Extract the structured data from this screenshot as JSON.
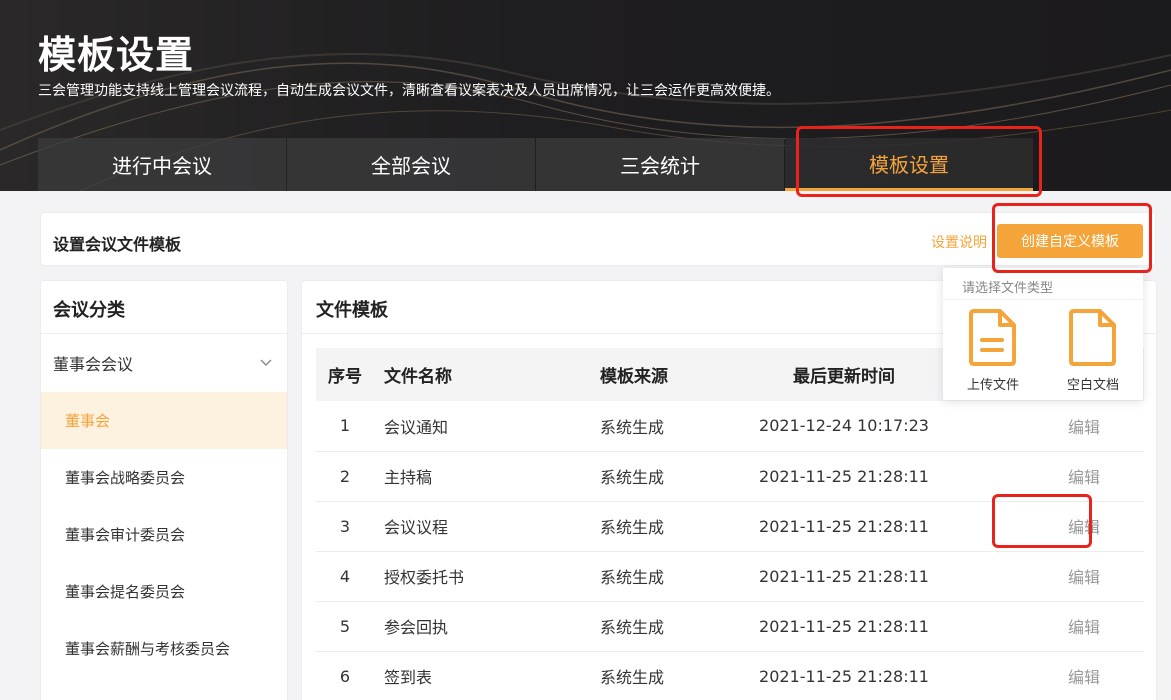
{
  "hero": {
    "title": "模板设置",
    "subtitle": "三会管理功能支持线上管理会议流程，自动生成会议文件，清晰查看议案表决及人员出席情况，让三会运作更高效便捷。"
  },
  "tabs": [
    {
      "label": "进行中会议",
      "active": false
    },
    {
      "label": "全部会议",
      "active": false
    },
    {
      "label": "三会统计",
      "active": false
    },
    {
      "label": "模板设置",
      "active": true
    }
  ],
  "toolbar": {
    "title": "设置会议文件模板",
    "help_label": "设置说明",
    "create_label": "创建自定义模板"
  },
  "sidebar": {
    "title": "会议分类",
    "group_label": "董事会会议",
    "items": [
      {
        "label": "董事会",
        "active": true
      },
      {
        "label": "董事会战略委员会",
        "active": false
      },
      {
        "label": "董事会审计委员会",
        "active": false
      },
      {
        "label": "董事会提名委员会",
        "active": false
      },
      {
        "label": "董事会薪酬与考核委员会",
        "active": false
      }
    ]
  },
  "main": {
    "title": "文件模板",
    "columns": [
      "序号",
      "文件名称",
      "模板来源",
      "最后更新时间"
    ],
    "rows": [
      {
        "no": "1",
        "name": "会议通知",
        "source": "系统生成",
        "time": "2021-12-24 10:17:23",
        "action": "编辑"
      },
      {
        "no": "2",
        "name": "主持稿",
        "source": "系统生成",
        "time": "2021-11-25 21:28:11",
        "action": "编辑"
      },
      {
        "no": "3",
        "name": "会议议程",
        "source": "系统生成",
        "time": "2021-11-25 21:28:11",
        "action": "编辑"
      },
      {
        "no": "4",
        "name": "授权委托书",
        "source": "系统生成",
        "time": "2021-11-25 21:28:11",
        "action": "编辑"
      },
      {
        "no": "5",
        "name": "参会回执",
        "source": "系统生成",
        "time": "2021-11-25 21:28:11",
        "action": "编辑"
      },
      {
        "no": "6",
        "name": "签到表",
        "source": "系统生成",
        "time": "2021-11-25 21:28:11",
        "action": "编辑"
      }
    ]
  },
  "popup": {
    "title": "请选择文件类型",
    "options": [
      {
        "label": "上传文件",
        "icon": "upload-file-icon"
      },
      {
        "label": "空白文档",
        "icon": "blank-doc-icon"
      }
    ]
  },
  "colors": {
    "accent": "#f5a43a",
    "highlight": "#e8231b",
    "hero_bg": "#1e1d1f"
  }
}
